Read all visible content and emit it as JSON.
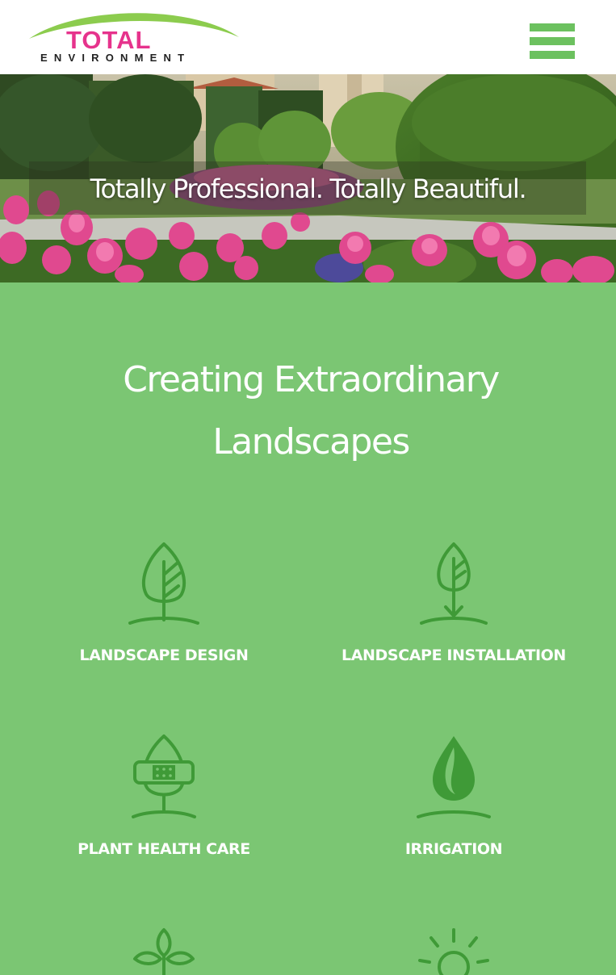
{
  "brand": {
    "name_line1": "TOTAL",
    "name_line2": "ENVIRONMENT",
    "colors": {
      "green": "#6cc15f",
      "pink": "#e6338c",
      "dark": "#222222",
      "page_green": "#7bc673",
      "icon_green": "#3f9a37"
    }
  },
  "header": {
    "menu_icon": "hamburger-menu-icon"
  },
  "hero": {
    "tagline": "Totally Professional. Totally Beautiful."
  },
  "main": {
    "headline": "Creating Extraordinary Landscapes"
  },
  "services": [
    {
      "label": "LANDSCAPE DESIGN",
      "icon": "leaf-icon"
    },
    {
      "label": "LANDSCAPE INSTALLATION",
      "icon": "leaf-planting-icon"
    },
    {
      "label": "PLANT HEALTH CARE",
      "icon": "bandaged-plant-icon"
    },
    {
      "label": "IRRIGATION",
      "icon": "water-drop-icon"
    },
    {
      "label": "",
      "icon": "sprout-icon"
    },
    {
      "label": "",
      "icon": "sun-icon"
    }
  ]
}
